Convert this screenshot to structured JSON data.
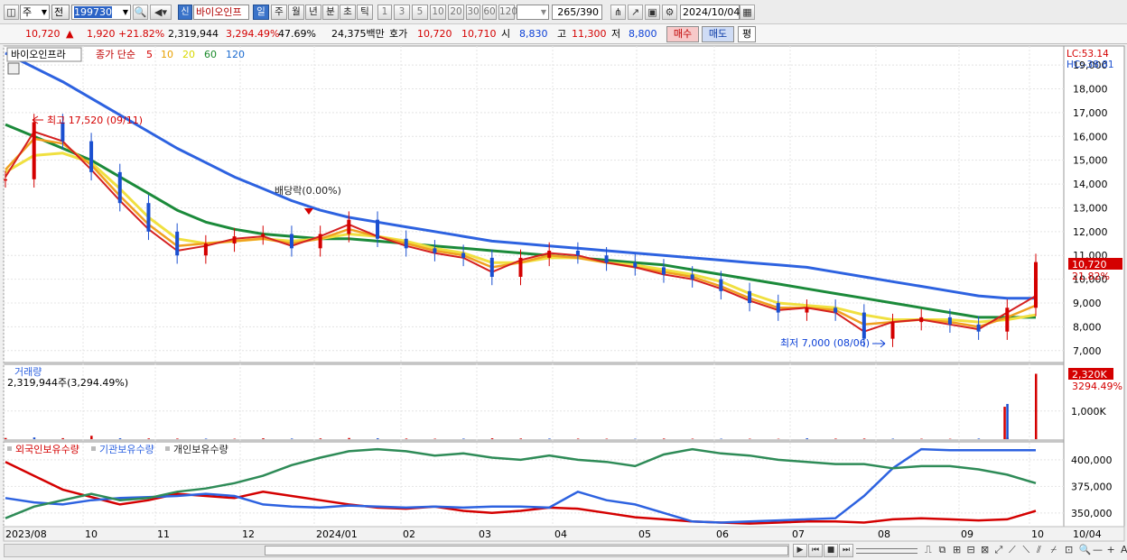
{
  "toolbar": {
    "period_type": "주",
    "prev_label": "전",
    "stock_code": "199730",
    "stock_name": "바이오인프",
    "new_badge": "신",
    "period_tabs": [
      "일",
      "주",
      "월",
      "년",
      "분",
      "초",
      "틱"
    ],
    "active_tab": "일",
    "intervals": [
      "1",
      "3",
      "5",
      "10",
      "20",
      "30",
      "60",
      "120"
    ],
    "count_current": "265",
    "count_total": "/390",
    "date": "2024/10/04"
  },
  "quote": {
    "price": "10,720",
    "change": "1,920",
    "change_pct": "+21.82%",
    "volume": "2,319,944",
    "volume_pct": "3,294.49%",
    "turnover": "47.69%",
    "amount": "24,375백만",
    "bid_label": "호가",
    "ask_price": "10,720",
    "bid_price": "10,710",
    "open_label": "시",
    "open": "8,830",
    "high_label": "고",
    "high": "11,300",
    "low_label": "저",
    "low": "8,800",
    "buy_label": "매수",
    "sell_label": "매도",
    "eval_label": "평"
  },
  "legend": {
    "stock": "바이오인프라",
    "ma_prefix": "종가 단순",
    "ma": [
      {
        "period": "5",
        "color": "#d40000"
      },
      {
        "period": "10",
        "color": "#e8a000"
      },
      {
        "period": "20",
        "color": "#d8d800"
      },
      {
        "period": "60",
        "color": "#1a8a2a"
      },
      {
        "period": "120",
        "color": "#1a6ad0"
      }
    ]
  },
  "lc_label": "LC:53.14",
  "hc_label": "HC:-38.81",
  "annotations": {
    "high": "최고 17,520 (09/11)",
    "dividend": "배당락(0.00%)",
    "low": "최저 7,000 (08/06)"
  },
  "price_badge": {
    "price": "10,720",
    "pct": "21.82%"
  },
  "volume_panel": {
    "title": "거래량",
    "value": "2,319,944주(3,294.49%)",
    "badge": "2,320K",
    "badge_pct": "3294.49%",
    "axis_tick": "1,000K"
  },
  "holder_panel": {
    "legend": [
      "외국인보유수량",
      "기관보유수량",
      "개인보유수량"
    ]
  },
  "date_axis": [
    "2023/08",
    "10",
    "11",
    "12",
    "2024/01",
    "02",
    "03",
    "04",
    "05",
    "06",
    "07",
    "08",
    "09",
    "10"
  ],
  "date_axis_right": "10/04",
  "chart_data": {
    "type": "line",
    "price_axis": [
      "19,000",
      "18,000",
      "17,000",
      "16,000",
      "15,000",
      "14,000",
      "13,000",
      "12,000",
      "11,000",
      "10,000",
      "9,000",
      "8,000",
      "7,000"
    ],
    "ylim": [
      6500,
      19800
    ],
    "months": [
      "2023/08",
      "10",
      "11",
      "12",
      "2024/01",
      "02",
      "03",
      "04",
      "05",
      "06",
      "07",
      "08",
      "09",
      "10"
    ],
    "close": [
      14200,
      16600,
      15800,
      14500,
      13200,
      12000,
      11000,
      11500,
      11800,
      11900,
      11300,
      11900,
      12500,
      11700,
      11300,
      11100,
      10900,
      10100,
      10900,
      11200,
      11000,
      10700,
      10500,
      10200,
      10000,
      9500,
      9000,
      8600,
      8800,
      8600,
      7500,
      8200,
      8400,
      8100,
      7800,
      8800,
      10720
    ],
    "ma5": [
      14300,
      16200,
      15800,
      14600,
      13300,
      12100,
      11200,
      11400,
      11700,
      11800,
      11400,
      11800,
      12300,
      11800,
      11400,
      11100,
      10900,
      10300,
      10800,
      11100,
      11000,
      10700,
      10500,
      10200,
      10000,
      9600,
      9100,
      8700,
      8800,
      8600,
      7800,
      8200,
      8300,
      8100,
      7900,
      8600,
      9300
    ],
    "ma10": [
      14600,
      15900,
      15700,
      14800,
      13500,
      12300,
      11400,
      11500,
      11600,
      11700,
      11500,
      11700,
      12100,
      11800,
      11500,
      11200,
      11000,
      10500,
      10700,
      11000,
      10900,
      10700,
      10500,
      10300,
      10100,
      9700,
      9200,
      8800,
      8800,
      8700,
      8100,
      8200,
      8300,
      8200,
      8000,
      8400,
      8900
    ],
    "ma20": [
      14500,
      15200,
      15300,
      14900,
      13800,
      12600,
      11700,
      11500,
      11600,
      11700,
      11600,
      11700,
      11900,
      11800,
      11600,
      11300,
      11100,
      10700,
      10700,
      10900,
      10900,
      10700,
      10600,
      10400,
      10200,
      9900,
      9400,
      9000,
      8900,
      8800,
      8500,
      8300,
      8300,
      8300,
      8200,
      8300,
      8500
    ],
    "ma60": [
      16500,
      16000,
      15500,
      15000,
      14300,
      13600,
      12900,
      12400,
      12100,
      11900,
      11800,
      11700,
      11700,
      11600,
      11500,
      11400,
      11300,
      11200,
      11100,
      11000,
      10900,
      10800,
      10700,
      10600,
      10400,
      10200,
      10000,
      9800,
      9600,
      9400,
      9200,
      9000,
      8800,
      8600,
      8400,
      8400,
      8400
    ],
    "ma120": [
      19500,
      18900,
      18300,
      17600,
      16900,
      16200,
      15500,
      14900,
      14300,
      13800,
      13300,
      12900,
      12600,
      12400,
      12200,
      12000,
      11800,
      11600,
      11500,
      11400,
      11300,
      11200,
      11100,
      11000,
      10900,
      10800,
      10700,
      10600,
      10500,
      10300,
      10100,
      9900,
      9700,
      9500,
      9300,
      9200,
      9200
    ],
    "volume_axis": [
      "1,000K"
    ],
    "volume_spike": [
      {
        "label": "2,320K",
        "value": 2320
      }
    ],
    "holder_axis": [
      "400,000",
      "375,000",
      "350,000"
    ],
    "holder_ylim": [
      338000,
      416000
    ],
    "foreign": [
      398000,
      385000,
      372000,
      365000,
      358000,
      362000,
      368000,
      366000,
      364000,
      370000,
      366000,
      362000,
      358000,
      355000,
      354000,
      356000,
      352000,
      350000,
      352000,
      355000,
      354000,
      350000,
      346000,
      344000,
      342000,
      341000,
      340000,
      341000,
      342000,
      342000,
      341000,
      344000,
      345000,
      344000,
      343000,
      344000,
      352000
    ],
    "institution": [
      364000,
      360000,
      358000,
      362000,
      364000,
      365000,
      366000,
      368000,
      366000,
      358000,
      356000,
      355000,
      357000,
      356000,
      355000,
      356000,
      355000,
      356000,
      356000,
      355000,
      370000,
      362000,
      358000,
      350000,
      342000,
      341000,
      342000,
      343000,
      344000,
      345000,
      366000,
      392000,
      410000,
      409000,
      409000,
      409000,
      409000
    ],
    "individual": [
      345000,
      356000,
      362000,
      368000,
      362000,
      364000,
      370000,
      373000,
      378000,
      385000,
      395000,
      402000,
      408000,
      410000,
      408000,
      404000,
      406000,
      402000,
      400000,
      404000,
      400000,
      398000,
      394000,
      405000,
      410000,
      406000,
      404000,
      400000,
      398000,
      396000,
      396000,
      392000,
      394000,
      394000,
      391000,
      386000,
      378000
    ]
  }
}
